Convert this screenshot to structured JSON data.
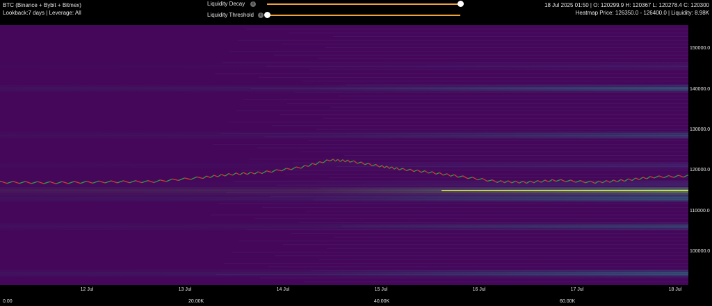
{
  "header": {
    "symbol": "BTC (Binance + Bybit + Bitmex)",
    "settings": "Lookback:7 days | Leverage: All",
    "ohlc": "18 Jul 2025 01:50 | O: 120299.9 H: 120367 L: 120278.4 C: 120300",
    "heatmap_info": "Heatmap Price: 126350.0 - 126400.0 | Liquidity: 8.98K"
  },
  "controls": {
    "decay_label": "Liquidity Decay",
    "decay_value": 1.0,
    "threshold_label": "Liquidity Threshold",
    "threshold_value": 0.0,
    "info_glyph": "i",
    "slider_color": "#f0a23c"
  },
  "chart_data": {
    "type": "heatmap",
    "y_ticks": [
      "150000.0",
      "140000.0",
      "130000.0",
      "120000.0",
      "110000.0",
      "100000.0"
    ],
    "y_tick_values": [
      150000,
      140000,
      130000,
      120000,
      110000,
      100000
    ],
    "ylim": [
      92000,
      156000
    ],
    "x_ticks": [
      "12 Jul",
      "13 Jul",
      "14 Jul",
      "15 Jul",
      "16 Jul",
      "17 Jul",
      "18 Jul"
    ],
    "legend_ticks": [
      "0.00",
      "20.00K",
      "40.00K",
      "60.00K"
    ],
    "background_color": "#44075a",
    "band_color_low": "#3b528b",
    "band_color_mid": "#21918c",
    "band_color_high": "#5ec962",
    "price_color_up": "#2ea043",
    "price_color_down": "#d23c2c",
    "bands": [
      {
        "price": 95000,
        "intensity": 0.75
      },
      {
        "price": 106500,
        "intensity": 0.55
      },
      {
        "price": 113500,
        "intensity": 0.8
      },
      {
        "price": 115300,
        "intensity": 1.0
      },
      {
        "price": 117000,
        "intensity": 0.5
      },
      {
        "price": 121500,
        "intensity": 0.45
      },
      {
        "price": 129000,
        "intensity": 0.55
      },
      {
        "price": 140500,
        "intensity": 0.7
      },
      {
        "price": 146000,
        "intensity": 0.3
      }
    ],
    "price_series": [
      [
        0,
        116800
      ],
      [
        0.5,
        117200
      ],
      [
        1,
        117300
      ],
      [
        1.5,
        117200
      ],
      [
        2,
        117400
      ],
      [
        2.5,
        117500
      ],
      [
        3,
        118500
      ],
      [
        3.3,
        119300
      ],
      [
        3.6,
        119700
      ],
      [
        4,
        121000
      ],
      [
        4.3,
        122800
      ],
      [
        4.5,
        122500
      ],
      [
        4.8,
        121300
      ],
      [
        5,
        120600
      ],
      [
        5.3,
        119800
      ],
      [
        5.6,
        118800
      ],
      [
        6,
        117500
      ],
      [
        6.3,
        117300
      ],
      [
        6.6,
        117800
      ],
      [
        7,
        117300
      ],
      [
        7.3,
        117800
      ],
      [
        7.6,
        118600
      ],
      [
        8,
        118900
      ],
      [
        8.3,
        119300
      ],
      [
        8.6,
        119700
      ],
      [
        9,
        119000
      ],
      [
        9.3,
        119100
      ],
      [
        9.6,
        119600
      ],
      [
        10,
        119900
      ],
      [
        10.3,
        120100
      ],
      [
        10.6,
        120200
      ],
      [
        10.9,
        120300
      ]
    ]
  }
}
